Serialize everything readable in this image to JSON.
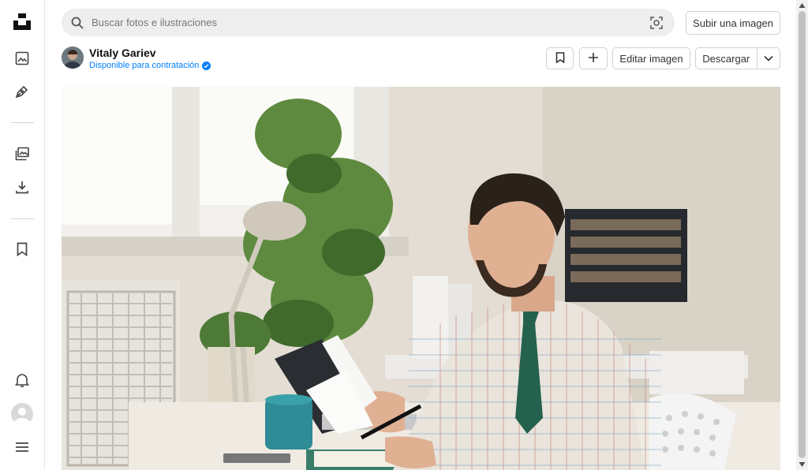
{
  "search": {
    "placeholder": "Buscar fotos e ilustraciones"
  },
  "header": {
    "submit_label": "Subir una imagen"
  },
  "author": {
    "name": "Vitaly Gariev",
    "hire_label": "Disponible para contratación"
  },
  "actions": {
    "edit_label": "Editar imagen",
    "download_label": "Descargar"
  },
  "sidebar": {
    "icons": [
      "unsplash-logo",
      "image-icon",
      "pen-icon",
      "collections-icon",
      "download-icon",
      "bookmark-icon",
      "bell-icon",
      "avatar",
      "menu-icon"
    ]
  },
  "colors": {
    "accent": "#007fff",
    "search_bg": "#eeeeee"
  }
}
